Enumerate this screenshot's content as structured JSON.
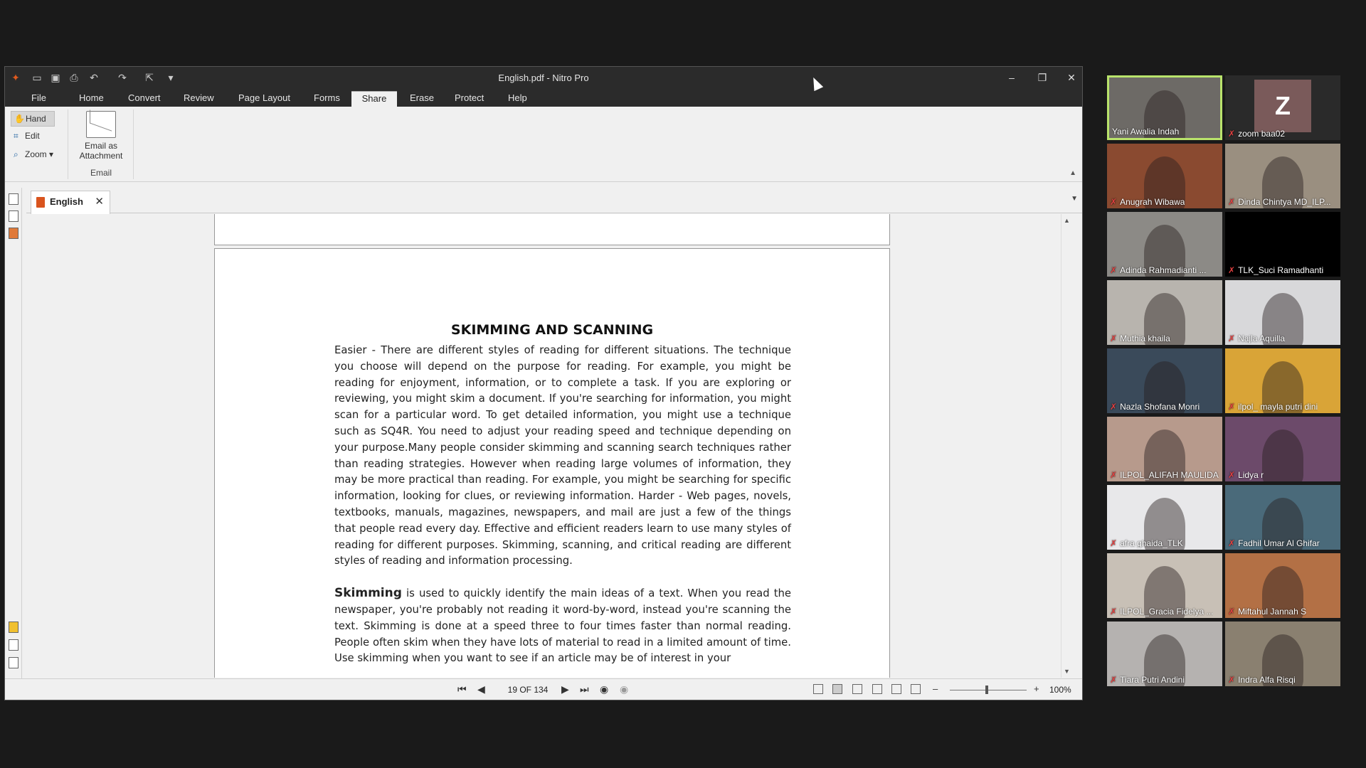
{
  "window": {
    "title": "English.pdf - Nitro Pro",
    "controls": {
      "minimize": "–",
      "restore": "❐",
      "close": "✕"
    }
  },
  "menu": {
    "tabs": [
      "File",
      "Home",
      "Convert",
      "Review",
      "Page Layout",
      "Forms",
      "Share",
      "Erase",
      "Protect",
      "Help"
    ],
    "active": "Share"
  },
  "ribbon": {
    "tools": {
      "hand": "Hand",
      "edit": "Edit",
      "zoom": "Zoom"
    },
    "email_button": "Email as\nAttachment",
    "group_label": "Email"
  },
  "document_tab": {
    "label": "English"
  },
  "document": {
    "title": "SKIMMING AND SCANNING",
    "paragraph1": "Easier - There are different styles of reading for different situations. The technique you choose will depend on the purpose for reading. For example, you might be reading for enjoyment, information, or to complete a task. If you are exploring or reviewing, you might skim a document. If you're searching for information, you might scan for a particular word. To get detailed information, you might use a technique such as SQ4R. You need to adjust your reading speed and technique depending on your purpose.Many people consider skimming and scanning search techniques rather than reading strategies. However when reading large volumes of information, they may be more practical than reading. For example, you might be searching for specific information, looking for clues, or reviewing information. Harder - Web pages, novels, textbooks, manuals, magazines, newspapers, and mail are just a few of the things that people read every day. Effective and efficient readers learn to use many styles of reading for different purposes. Skimming, scanning, and critical reading are different styles of reading and information processing.",
    "paragraph2_lead": "Skimming",
    "paragraph2": " is used to quickly identify the main ideas of a text. When you read the newspaper, you're probably not reading it word-by-word, instead you're scanning the text. Skimming is done at a speed three to four times faster than normal reading. People often skim when they have lots of material to read in a limited amount of time. Use skimming when you want to see if an article may be of interest in your"
  },
  "statusbar": {
    "page_indicator": "19 OF 134",
    "zoom_level": "100%",
    "zoom_minus": "–",
    "zoom_plus": "+"
  },
  "participants": [
    {
      "name": "Yani Awalia Indah",
      "active": true,
      "color": "#6d6a66"
    },
    {
      "name": "zoom baa02",
      "initial": "Z",
      "color": "#2a2a2a"
    },
    {
      "name": "Anugrah Wibawa",
      "color": "#8a4a30"
    },
    {
      "name": "Dinda Chintya MD_ILP...",
      "color": "#9a8f80"
    },
    {
      "name": "Adinda Rahmadianti ...",
      "color": "#8c8a86"
    },
    {
      "name": "TLK_Suci Ramadhanti",
      "color": "#000000"
    },
    {
      "name": "Muthia khaila",
      "color": "#b8b4ae"
    },
    {
      "name": "Najla Aquilla",
      "color": "#d8d8da"
    },
    {
      "name": "Nazla Shofana Monri",
      "color": "#3a4a5a"
    },
    {
      "name": "ilpol_ mayla putri dini",
      "color": "#d9a437"
    },
    {
      "name": "ILPOL_ALIFAH MAULIDA",
      "color": "#b79a8c"
    },
    {
      "name": "Lidya r",
      "color": "#6c4a6a"
    },
    {
      "name": "afra ghaida_TLK",
      "color": "#e8e8ea"
    },
    {
      "name": "Fadhil Umar Al Ghifar",
      "color": "#4a6a7a"
    },
    {
      "name": "ILPOL_Gracia Fidelya ...",
      "color": "#c8c0b6"
    },
    {
      "name": "Miftahul Jannah S",
      "color": "#b37045"
    },
    {
      "name": "Tiara Putri Andini",
      "color": "#b5b2b0"
    },
    {
      "name": "Indra Alfa Risqi",
      "color": "#8a8070"
    }
  ]
}
